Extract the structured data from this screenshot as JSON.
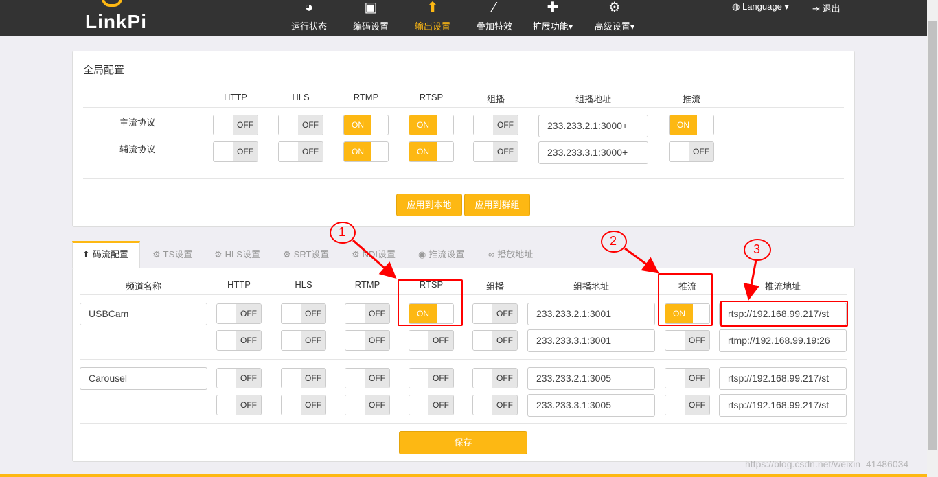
{
  "brand": "LinkPi",
  "nav": [
    {
      "label": "运行状态",
      "icon": "dashboard-icon",
      "glyph": "◕"
    },
    {
      "label": "编码设置",
      "icon": "image-icon",
      "glyph": "▣"
    },
    {
      "label": "输出设置",
      "icon": "upload-icon",
      "glyph": "⬆",
      "active": true
    },
    {
      "label": "叠加特效",
      "icon": "magic-wand-icon",
      "glyph": "⁄"
    },
    {
      "label": "扩展功能▾",
      "icon": "puzzle-icon",
      "glyph": "✚"
    },
    {
      "label": "高级设置▾",
      "icon": "gears-icon",
      "glyph": "⚙"
    }
  ],
  "language": "Language ▾",
  "logout": "退出",
  "global": {
    "title": "全局配置",
    "headers": [
      "HTTP",
      "HLS",
      "RTMP",
      "RTSP",
      "组播",
      "组播地址",
      "推流"
    ],
    "rows": [
      {
        "label": "主流协议",
        "toggles": [
          "OFF",
          "OFF",
          "ON",
          "ON",
          "OFF"
        ],
        "multicast": "233.233.2.1:3000+",
        "push": "ON"
      },
      {
        "label": "辅流协议",
        "toggles": [
          "OFF",
          "OFF",
          "ON",
          "ON",
          "OFF"
        ],
        "multicast": "233.233.3.1:3000+",
        "push": "OFF"
      }
    ],
    "apply_local": "应用到本地",
    "apply_group": "应用到群组"
  },
  "tabs": [
    {
      "label": "码流配置",
      "icon": "upload-icon",
      "glyph": "⬆",
      "active": true
    },
    {
      "label": "TS设置",
      "icon": "gear-icon",
      "glyph": "⚙"
    },
    {
      "label": "HLS设置",
      "icon": "gear-icon",
      "glyph": "⚙"
    },
    {
      "label": "SRT设置",
      "icon": "gear-icon",
      "glyph": "⚙"
    },
    {
      "label": "NDI设置",
      "icon": "gear-icon",
      "glyph": "⚙"
    },
    {
      "label": "推流设置",
      "icon": "podcast-icon",
      "glyph": "◉"
    },
    {
      "label": "播放地址",
      "icon": "link-icon",
      "glyph": "∞"
    }
  ],
  "streams": {
    "headers": [
      "频道名称",
      "HTTP",
      "HLS",
      "RTMP",
      "RTSP",
      "组播",
      "组播地址",
      "推流",
      "推流地址"
    ],
    "channels": [
      {
        "name": "USBCam",
        "rows": [
          {
            "toggles": [
              "OFF",
              "OFF",
              "OFF",
              "ON",
              "OFF"
            ],
            "multicast": "233.233.2.1:3001",
            "push": "ON",
            "url": "rtsp://192.168.99.217/st"
          },
          {
            "toggles": [
              "OFF",
              "OFF",
              "OFF",
              "OFF",
              "OFF"
            ],
            "multicast": "233.233.3.1:3001",
            "push": "OFF",
            "url": "rtmp://192.168.99.19:26"
          }
        ]
      },
      {
        "name": "Carousel",
        "rows": [
          {
            "toggles": [
              "OFF",
              "OFF",
              "OFF",
              "OFF",
              "OFF"
            ],
            "multicast": "233.233.2.1:3005",
            "push": "OFF",
            "url": "rtsp://192.168.99.217/st"
          },
          {
            "toggles": [
              "OFF",
              "OFF",
              "OFF",
              "OFF",
              "OFF"
            ],
            "multicast": "233.233.3.1:3005",
            "push": "OFF",
            "url": "rtsp://192.168.99.217/st"
          }
        ]
      }
    ],
    "save": "保存"
  },
  "annotations": [
    "1",
    "2",
    "3"
  ],
  "watermark": "https://blog.csdn.net/weixin_41486034",
  "colors": {
    "accent": "#fdb813",
    "topbar": "#333333",
    "annotation": "#ff0000"
  }
}
